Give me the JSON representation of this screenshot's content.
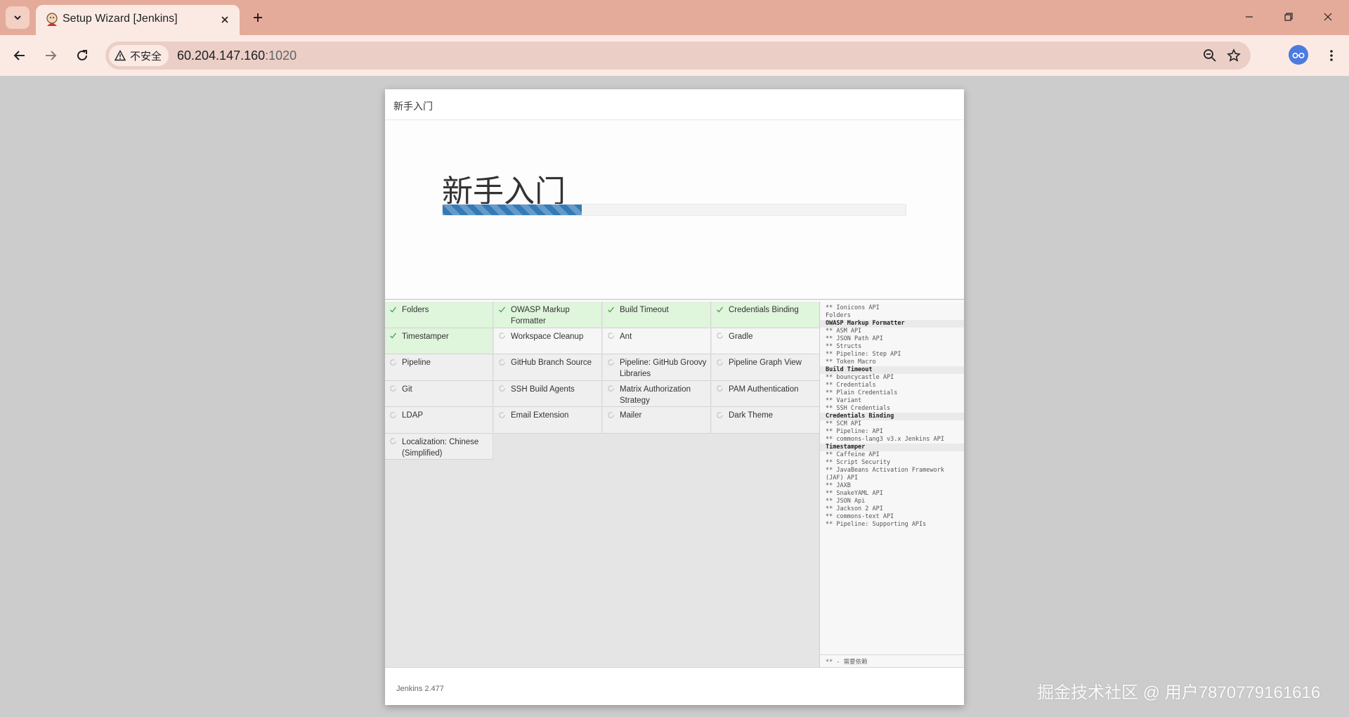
{
  "browser": {
    "tab_title": "Setup Wizard [Jenkins]",
    "security_label": "不安全",
    "url_host": "60.204.147.160",
    "url_port": ":1020"
  },
  "dialog": {
    "header_title": "新手入门",
    "hero_title": "新手入门",
    "progress_fraction": 0.3,
    "footer_version": "Jenkins 2.477"
  },
  "plugins": [
    {
      "name": "Folders",
      "status": "success"
    },
    {
      "name": "OWASP Markup Formatter",
      "status": "success"
    },
    {
      "name": "Build Timeout",
      "status": "success"
    },
    {
      "name": "Credentials Binding",
      "status": "success"
    },
    {
      "name": "Timestamper",
      "status": "success"
    },
    {
      "name": "Workspace Cleanup",
      "status": "pending"
    },
    {
      "name": "Ant",
      "status": "pending"
    },
    {
      "name": "Gradle",
      "status": "pending"
    },
    {
      "name": "Pipeline",
      "status": "waiting"
    },
    {
      "name": "GitHub Branch Source",
      "status": "waiting"
    },
    {
      "name": "Pipeline: GitHub Groovy Libraries",
      "status": "waiting"
    },
    {
      "name": "Pipeline Graph View",
      "status": "waiting"
    },
    {
      "name": "Git",
      "status": "waiting"
    },
    {
      "name": "SSH Build Agents",
      "status": "waiting"
    },
    {
      "name": "Matrix Authorization Strategy",
      "status": "waiting"
    },
    {
      "name": "PAM Authentication",
      "status": "waiting"
    },
    {
      "name": "LDAP",
      "status": "waiting"
    },
    {
      "name": "Email Extension",
      "status": "waiting"
    },
    {
      "name": "Mailer",
      "status": "waiting"
    },
    {
      "name": "Dark Theme",
      "status": "waiting"
    },
    {
      "name": "Localization: Chinese (Simplified)",
      "status": "waiting"
    }
  ],
  "install_log": [
    {
      "text": "** Ionicons API",
      "header": false
    },
    {
      "text": "Folders",
      "header": false
    },
    {
      "text": "OWASP Markup Formatter",
      "header": true
    },
    {
      "text": "** ASM API",
      "header": false
    },
    {
      "text": "** JSON Path API",
      "header": false
    },
    {
      "text": "** Structs",
      "header": false
    },
    {
      "text": "** Pipeline: Step API",
      "header": false
    },
    {
      "text": "** Token Macro",
      "header": false
    },
    {
      "text": "Build Timeout",
      "header": true
    },
    {
      "text": "** bouncycastle API",
      "header": false
    },
    {
      "text": "** Credentials",
      "header": false
    },
    {
      "text": "** Plain Credentials",
      "header": false
    },
    {
      "text": "** Variant",
      "header": false
    },
    {
      "text": "** SSH Credentials",
      "header": false
    },
    {
      "text": "Credentials Binding",
      "header": true
    },
    {
      "text": "** SCM API",
      "header": false
    },
    {
      "text": "** Pipeline: API",
      "header": false
    },
    {
      "text": "** commons-lang3 v3.x Jenkins API",
      "header": false
    },
    {
      "text": "Timestamper",
      "header": true
    },
    {
      "text": "** Caffeine API",
      "header": false
    },
    {
      "text": "** Script Security",
      "header": false
    },
    {
      "text": "** JavaBeans Activation Framework (JAF) API",
      "header": false,
      "wrap": true
    },
    {
      "text": "** JAXB",
      "header": false
    },
    {
      "text": "** SnakeYAML API",
      "header": false
    },
    {
      "text": "** JSON Api",
      "header": false
    },
    {
      "text": "** Jackson 2 API",
      "header": false
    },
    {
      "text": "** commons-text API",
      "header": false
    },
    {
      "text": "** Pipeline: Supporting APIs",
      "header": false
    }
  ],
  "log_footer": "** - 需要依赖",
  "watermark": "掘金技术社区 @ 用户787077916​1616"
}
